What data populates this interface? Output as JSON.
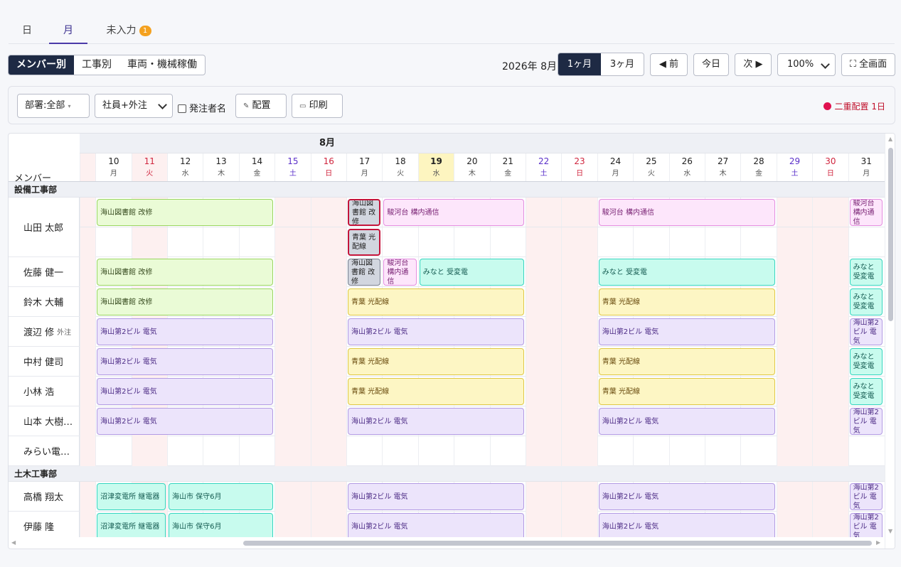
{
  "tabs": [
    {
      "label": "日"
    },
    {
      "label": "月"
    },
    {
      "label": "未入力",
      "badge": "1"
    }
  ],
  "view_segments": [
    "メンバー別",
    "工事別",
    "車両・機械稼働"
  ],
  "period": {
    "month_label": "2026年 8月",
    "ranges": [
      "1ヶ月",
      "3ヶ月"
    ],
    "prev": "◀ 前",
    "today": "今日",
    "next": "次 ▶",
    "zoom": "100%",
    "fullscreen": "⛶ 全画面"
  },
  "toolbar": {
    "dept": "部署:全部",
    "dept_caret": "▾",
    "emp_type": "社員+外注",
    "orderer_label": "発注者名",
    "assign": "配置",
    "print": "印刷",
    "double_booking": "二重配置 1日"
  },
  "grid": {
    "month": "8月",
    "member_header": "メンバー",
    "days": [
      {
        "d": "10",
        "w": "月",
        "t": "wd"
      },
      {
        "d": "11",
        "w": "火",
        "t": "hol"
      },
      {
        "d": "12",
        "w": "水",
        "t": "wd"
      },
      {
        "d": "13",
        "w": "木",
        "t": "wd"
      },
      {
        "d": "14",
        "w": "金",
        "t": "wd"
      },
      {
        "d": "15",
        "w": "土",
        "t": "sat"
      },
      {
        "d": "16",
        "w": "日",
        "t": "sun"
      },
      {
        "d": "17",
        "w": "月",
        "t": "wd"
      },
      {
        "d": "18",
        "w": "火",
        "t": "wd"
      },
      {
        "d": "19",
        "w": "水",
        "t": "today"
      },
      {
        "d": "20",
        "w": "木",
        "t": "wd"
      },
      {
        "d": "21",
        "w": "金",
        "t": "wd"
      },
      {
        "d": "22",
        "w": "土",
        "t": "sat"
      },
      {
        "d": "23",
        "w": "日",
        "t": "sun"
      },
      {
        "d": "24",
        "w": "月",
        "t": "wd"
      },
      {
        "d": "25",
        "w": "火",
        "t": "wd"
      },
      {
        "d": "26",
        "w": "水",
        "t": "wd"
      },
      {
        "d": "27",
        "w": "木",
        "t": "wd"
      },
      {
        "d": "28",
        "w": "金",
        "t": "wd"
      },
      {
        "d": "29",
        "w": "土",
        "t": "sat"
      },
      {
        "d": "30",
        "w": "日",
        "t": "sun"
      },
      {
        "d": "31",
        "w": "月",
        "t": "wd"
      }
    ],
    "sections": [
      {
        "name": "設備工事部",
        "members": [
          {
            "name": "山田 太郎",
            "tall": true,
            "bars": [
              {
                "s": 1,
                "e": 5,
                "c": "g",
                "t": "海山図書館 改修"
              },
              {
                "s": 8,
                "e": 8,
                "c": "gray",
                "t": "海山図書館 改修"
              },
              {
                "s": 9,
                "e": 12,
                "c": "p",
                "t": "駿河台 構内通信"
              },
              {
                "s": 15,
                "e": 19,
                "c": "p",
                "t": "駿河台 構内通信"
              },
              {
                "s": 22,
                "e": 22,
                "c": "p",
                "t": "駿河台 構内通信"
              },
              {
                "s": 8,
                "e": 8,
                "c": "gray",
                "t": "青葉 光配線",
                "l": 2
              }
            ]
          },
          {
            "name": "佐藤 健一",
            "bars": [
              {
                "s": 1,
                "e": 5,
                "c": "g",
                "t": "海山図書館 改修"
              },
              {
                "s": 8,
                "e": 8,
                "c": "gray2",
                "t": "海山図書館 改修"
              },
              {
                "s": 9,
                "e": 9,
                "c": "p",
                "t": "駿河台 構内通信"
              },
              {
                "s": 10,
                "e": 12,
                "c": "c",
                "t": "みなと 受変電"
              },
              {
                "s": 15,
                "e": 19,
                "c": "c",
                "t": "みなと 受変電"
              },
              {
                "s": 22,
                "e": 22,
                "c": "c",
                "t": "みなと 受変電"
              }
            ]
          },
          {
            "name": "鈴木 大輔",
            "bars": [
              {
                "s": 1,
                "e": 5,
                "c": "g",
                "t": "海山図書館 改修"
              },
              {
                "s": 8,
                "e": 12,
                "c": "y",
                "t": "青葉 光配線"
              },
              {
                "s": 15,
                "e": 19,
                "c": "y",
                "t": "青葉 光配線"
              },
              {
                "s": 22,
                "e": 22,
                "c": "c",
                "t": "みなと 受変電"
              }
            ]
          },
          {
            "name": "渡辺 修",
            "sub": "外注",
            "bars": [
              {
                "s": 1,
                "e": 5,
                "c": "v",
                "t": "海山第2ビル 電気"
              },
              {
                "s": 8,
                "e": 12,
                "c": "v",
                "t": "海山第2ビル 電気"
              },
              {
                "s": 15,
                "e": 19,
                "c": "v",
                "t": "海山第2ビル 電気"
              },
              {
                "s": 22,
                "e": 22,
                "c": "v",
                "t": "海山第2ビル 電気"
              }
            ]
          },
          {
            "name": "中村 健司",
            "bars": [
              {
                "s": 1,
                "e": 5,
                "c": "v",
                "t": "海山第2ビル 電気"
              },
              {
                "s": 8,
                "e": 12,
                "c": "y",
                "t": "青葉 光配線"
              },
              {
                "s": 15,
                "e": 19,
                "c": "y",
                "t": "青葉 光配線"
              },
              {
                "s": 22,
                "e": 22,
                "c": "c",
                "t": "みなと 受変電"
              }
            ]
          },
          {
            "name": "小林 浩",
            "bars": [
              {
                "s": 1,
                "e": 5,
                "c": "v",
                "t": "海山第2ビル 電気"
              },
              {
                "s": 8,
                "e": 12,
                "c": "y",
                "t": "青葉 光配線"
              },
              {
                "s": 15,
                "e": 19,
                "c": "y",
                "t": "青葉 光配線"
              },
              {
                "s": 22,
                "e": 22,
                "c": "c",
                "t": "みなと 受変電"
              }
            ]
          },
          {
            "name": "山本 大樹…",
            "bars": [
              {
                "s": 1,
                "e": 5,
                "c": "v",
                "t": "海山第2ビル 電気"
              },
              {
                "s": 8,
                "e": 12,
                "c": "v",
                "t": "海山第2ビル 電気"
              },
              {
                "s": 15,
                "e": 19,
                "c": "v",
                "t": "海山第2ビル 電気"
              },
              {
                "s": 22,
                "e": 22,
                "c": "v",
                "t": "海山第2ビル 電気"
              }
            ]
          },
          {
            "name": "みらい電…",
            "bars": []
          }
        ]
      },
      {
        "name": "土木工事部",
        "members": [
          {
            "name": "高橋 翔太",
            "bars": [
              {
                "s": 1,
                "e": 2,
                "c": "c",
                "t": "沼津変電所 継電器"
              },
              {
                "s": 3,
                "e": 5,
                "c": "c",
                "t": "海山市 保守6月"
              },
              {
                "s": 8,
                "e": 12,
                "c": "v",
                "t": "海山第2ビル 電気"
              },
              {
                "s": 15,
                "e": 19,
                "c": "v",
                "t": "海山第2ビル 電気"
              },
              {
                "s": 22,
                "e": 22,
                "c": "v",
                "t": "海山第2ビル 電気"
              }
            ]
          },
          {
            "name": "伊藤 隆",
            "bars": [
              {
                "s": 1,
                "e": 2,
                "c": "c",
                "t": "沼津変電所 継電器"
              },
              {
                "s": 3,
                "e": 5,
                "c": "c",
                "t": "海山市 保守6月"
              },
              {
                "s": 8,
                "e": 12,
                "c": "v",
                "t": "海山第2ビル 電気"
              },
              {
                "s": 15,
                "e": 19,
                "c": "v",
                "t": "海山第2ビル 電気"
              },
              {
                "s": 22,
                "e": 22,
                "c": "v",
                "t": "海山第2ビル 電気"
              }
            ]
          }
        ]
      }
    ]
  },
  "colors": {
    "accent": "#1e2a44",
    "saturday": "#5a2fc9",
    "sunday_holiday": "#d0253e",
    "today_bg": "#fdf5c0",
    "weekend_cell": "#fdf0f0",
    "alert": "#e0114f"
  }
}
